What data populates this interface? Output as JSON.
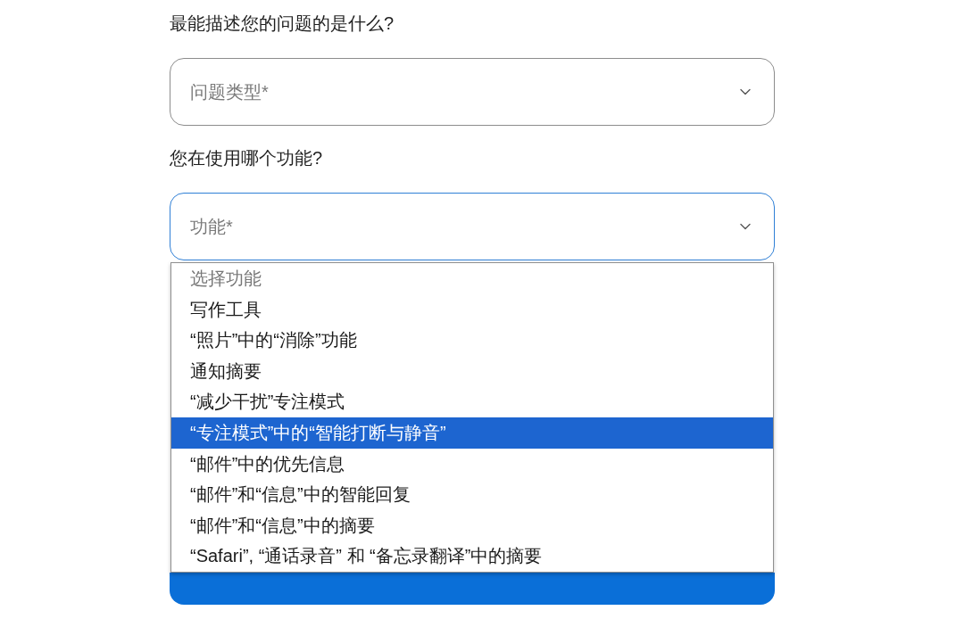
{
  "questions": [
    {
      "label": "最能描述您的问题的是什么?",
      "select": {
        "placeholder": "问题类型*",
        "focused": false
      }
    },
    {
      "label": "您在使用哪个功能?",
      "select": {
        "placeholder": "功能*",
        "focused": true,
        "expanded": true,
        "options": [
          {
            "label": "选择功能",
            "disabled": true,
            "selected": false
          },
          {
            "label": "写作工具",
            "disabled": false,
            "selected": false
          },
          {
            "label": "“照片”中的“消除”功能",
            "disabled": false,
            "selected": false
          },
          {
            "label": "通知摘要",
            "disabled": false,
            "selected": false
          },
          {
            "label": "“减少干扰”专注模式",
            "disabled": false,
            "selected": false
          },
          {
            "label": "“专注模式”中的“智能打断与静音”",
            "disabled": false,
            "selected": true
          },
          {
            "label": "“邮件”中的优先信息",
            "disabled": false,
            "selected": false
          },
          {
            "label": "“邮件”和“信息”中的智能回复",
            "disabled": false,
            "selected": false
          },
          {
            "label": "“邮件”和“信息”中的摘要",
            "disabled": false,
            "selected": false
          },
          {
            "label": "“Safari”, “通话录音” 和 “备忘录翻译”中的摘要",
            "disabled": false,
            "selected": false
          }
        ]
      }
    }
  ],
  "submit_button": {
    "kind": "primary"
  }
}
